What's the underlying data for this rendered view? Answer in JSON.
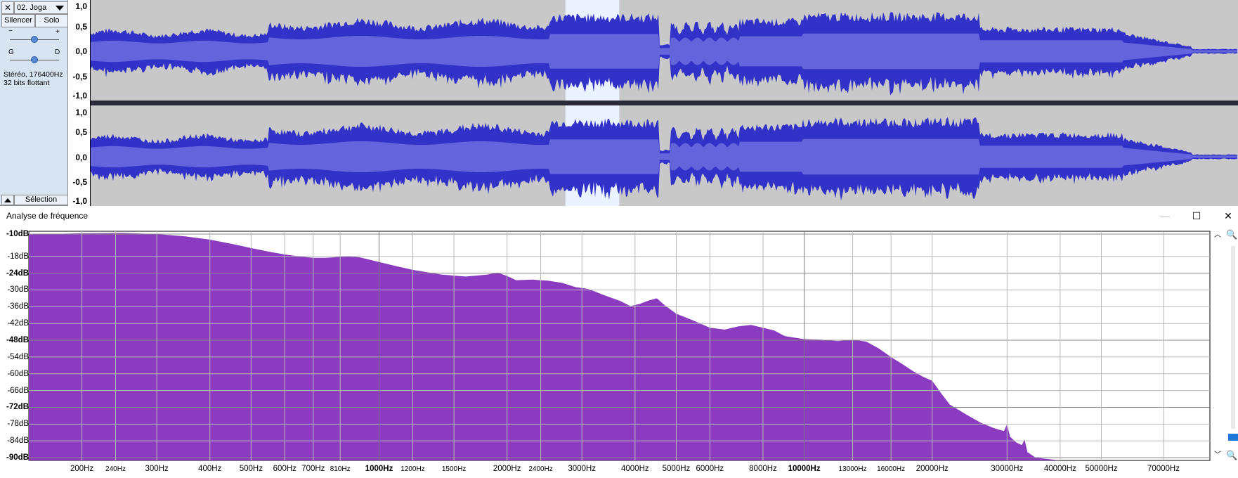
{
  "track": {
    "name": "02. Joga",
    "close_icon": "close-icon",
    "mute_label": "Silencer",
    "solo_label": "Solo",
    "gain_minus": "−",
    "gain_plus": "+",
    "pan_left": "G",
    "pan_right": "D",
    "info_line1": "Stéréo, 176400Hz",
    "info_line2": "32 bits flottant",
    "select_label": "Sélection",
    "ruler_labels_top": [
      "1,0",
      "0,5",
      "0,0",
      "-0,5",
      "-1,0"
    ],
    "ruler_labels_bottom": [
      "1,0",
      "0,5",
      "0,0",
      "-0,5",
      "-1,0"
    ],
    "waveform_color": "#3232c8",
    "rms_color": "#6464dc",
    "background_color": "#c8c8c8",
    "selection_color": "#eaf2ff",
    "selection_range": [
      0.455,
      0.49
    ]
  },
  "frequency_window": {
    "title": "Analyse de fréquence",
    "minimize_label": "—",
    "maximize_label": "☐",
    "close_label": "✕",
    "zoom_in_icon": "zoom-in-icon",
    "zoom_out_icon": "zoom-out-icon",
    "scroll_up_icon": "chevron-up-icon",
    "scroll_down_icon": "chevron-down-icon"
  },
  "chart_data": {
    "type": "area",
    "fill_color": "#8b3bbf",
    "x_scale": "log",
    "xlim": [
      150,
      90000
    ],
    "ylim": [
      -91,
      -9
    ],
    "y_ticks": [
      {
        "label": "-10dB",
        "value": -10,
        "bold": true
      },
      {
        "label": "-18dB",
        "value": -18,
        "bold": false
      },
      {
        "label": "-24dB",
        "value": -24,
        "bold": true
      },
      {
        "label": "-30dB",
        "value": -30,
        "bold": false
      },
      {
        "label": "-36dB",
        "value": -36,
        "bold": false
      },
      {
        "label": "-42dB",
        "value": -42,
        "bold": false
      },
      {
        "label": "-48dB",
        "value": -48,
        "bold": true
      },
      {
        "label": "-54dB",
        "value": -54,
        "bold": false
      },
      {
        "label": "-60dB",
        "value": -60,
        "bold": false
      },
      {
        "label": "-66dB",
        "value": -66,
        "bold": false
      },
      {
        "label": "-72dB",
        "value": -72,
        "bold": true
      },
      {
        "label": "-78dB",
        "value": -78,
        "bold": false
      },
      {
        "label": "-84dB",
        "value": -84,
        "bold": false
      },
      {
        "label": "-90dB",
        "value": -90,
        "bold": true
      }
    ],
    "x_ticks": [
      {
        "label": "200Hz",
        "value": 200,
        "size": "normal"
      },
      {
        "label": "240Hz",
        "value": 240,
        "size": "small"
      },
      {
        "label": "300Hz",
        "value": 300,
        "size": "normal"
      },
      {
        "label": "400Hz",
        "value": 400,
        "size": "normal"
      },
      {
        "label": "500Hz",
        "value": 500,
        "size": "normal"
      },
      {
        "label": "600Hz",
        "value": 600,
        "size": "normal"
      },
      {
        "label": "700Hz",
        "value": 700,
        "size": "normal"
      },
      {
        "label": "810Hz",
        "value": 810,
        "size": "small"
      },
      {
        "label": "1000Hz",
        "value": 1000,
        "size": "bold"
      },
      {
        "label": "1200Hz",
        "value": 1200,
        "size": "small"
      },
      {
        "label": "1500Hz",
        "value": 1500,
        "size": "small"
      },
      {
        "label": "2000Hz",
        "value": 2000,
        "size": "normal"
      },
      {
        "label": "2400Hz",
        "value": 2400,
        "size": "small"
      },
      {
        "label": "3000Hz",
        "value": 3000,
        "size": "normal"
      },
      {
        "label": "4000Hz",
        "value": 4000,
        "size": "normal"
      },
      {
        "label": "5000Hz",
        "value": 5000,
        "size": "normal"
      },
      {
        "label": "6000Hz",
        "value": 6000,
        "size": "normal"
      },
      {
        "label": "8000Hz",
        "value": 8000,
        "size": "normal"
      },
      {
        "label": "10000Hz",
        "value": 10000,
        "size": "bold"
      },
      {
        "label": "13000Hz",
        "value": 13000,
        "size": "small"
      },
      {
        "label": "16000Hz",
        "value": 16000,
        "size": "small"
      },
      {
        "label": "20000Hz",
        "value": 20000,
        "size": "normal"
      },
      {
        "label": "30000Hz",
        "value": 30000,
        "size": "normal"
      },
      {
        "label": "40000Hz",
        "value": 40000,
        "size": "normal"
      },
      {
        "label": "50000Hz",
        "value": 50000,
        "size": "normal"
      },
      {
        "label": "70000Hz",
        "value": 70000,
        "size": "normal"
      }
    ],
    "grid": true,
    "points": [
      [
        150,
        -10.2
      ],
      [
        200,
        -9.7
      ],
      [
        250,
        -9.6
      ],
      [
        300,
        -10.0
      ],
      [
        350,
        -10.8
      ],
      [
        400,
        -12.0
      ],
      [
        450,
        -13.5
      ],
      [
        500,
        -15.0
      ],
      [
        550,
        -16.3
      ],
      [
        600,
        -17.3
      ],
      [
        650,
        -18.0
      ],
      [
        700,
        -18.5
      ],
      [
        750,
        -18.5
      ],
      [
        800,
        -18.2
      ],
      [
        850,
        -18.0
      ],
      [
        900,
        -18.3
      ],
      [
        1000,
        -20.0
      ],
      [
        1100,
        -21.5
      ],
      [
        1200,
        -22.8
      ],
      [
        1400,
        -24.5
      ],
      [
        1600,
        -25.2
      ],
      [
        1800,
        -24.5
      ],
      [
        1900,
        -23.8
      ],
      [
        2000,
        -25.0
      ],
      [
        2100,
        -26.5
      ],
      [
        2300,
        -26.3
      ],
      [
        2500,
        -26.7
      ],
      [
        2700,
        -27.5
      ],
      [
        2900,
        -29.0
      ],
      [
        3100,
        -29.6
      ],
      [
        3400,
        -32.0
      ],
      [
        3700,
        -34.0
      ],
      [
        3900,
        -35.8
      ],
      [
        4100,
        -35.0
      ],
      [
        4300,
        -33.8
      ],
      [
        4500,
        -33.0
      ],
      [
        4700,
        -35.5
      ],
      [
        5000,
        -38.5
      ],
      [
        5500,
        -41.0
      ],
      [
        6000,
        -43.5
      ],
      [
        6500,
        -44.2
      ],
      [
        7000,
        -43.0
      ],
      [
        7500,
        -42.5
      ],
      [
        8000,
        -43.5
      ],
      [
        8500,
        -44.5
      ],
      [
        9000,
        -46.5
      ],
      [
        10000,
        -47.6
      ],
      [
        11000,
        -47.8
      ],
      [
        12000,
        -48.3
      ],
      [
        13000,
        -47.8
      ],
      [
        14000,
        -48.5
      ],
      [
        15000,
        -51.0
      ],
      [
        16000,
        -54.0
      ],
      [
        17000,
        -56.5
      ],
      [
        18000,
        -59.0
      ],
      [
        19000,
        -61.0
      ],
      [
        20000,
        -62.5
      ],
      [
        21000,
        -67.0
      ],
      [
        22000,
        -71.0
      ],
      [
        24000,
        -74.5
      ],
      [
        26000,
        -77.5
      ],
      [
        28000,
        -79.5
      ],
      [
        29500,
        -80.5
      ],
      [
        30000,
        -78.0
      ],
      [
        30500,
        -82.5
      ],
      [
        31500,
        -84.5
      ],
      [
        32500,
        -85.5
      ],
      [
        33000,
        -83.5
      ],
      [
        33500,
        -88.0
      ],
      [
        35000,
        -90.0
      ],
      [
        40000,
        -91.0
      ],
      [
        90000,
        -91.0
      ]
    ]
  }
}
